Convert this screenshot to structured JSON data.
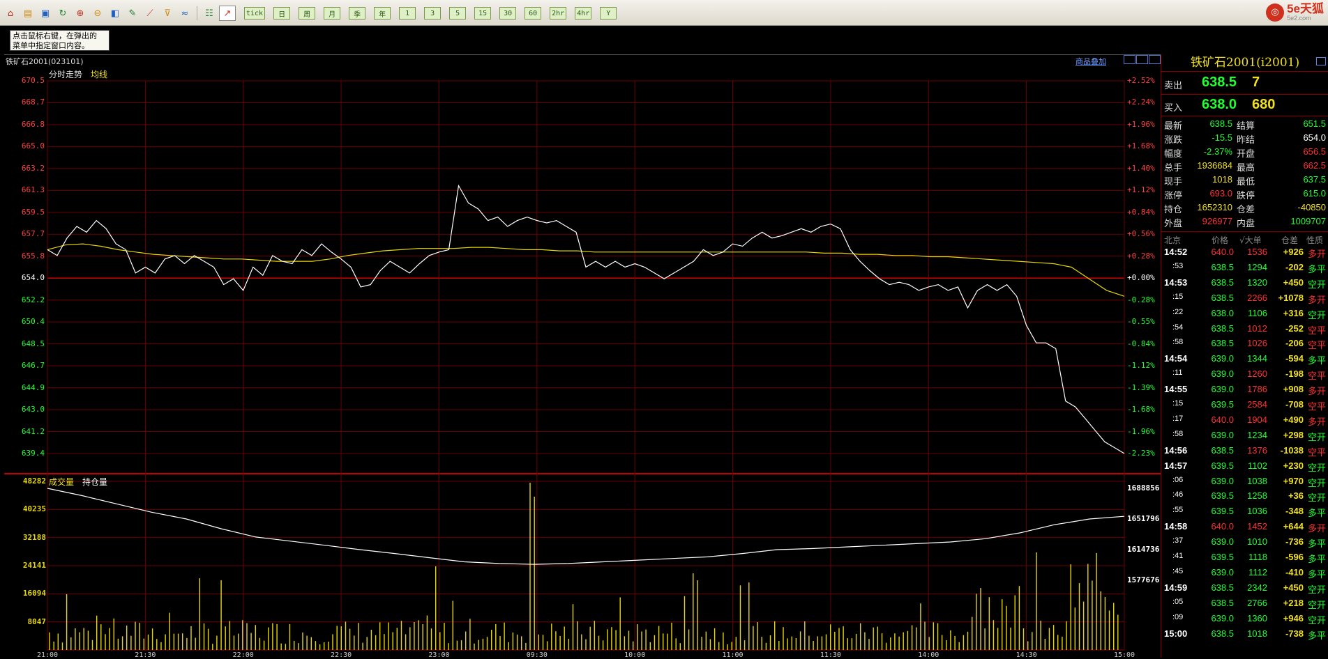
{
  "toolbar": {
    "icons": [
      "home-icon",
      "folder-icon",
      "layout-icon",
      "refresh-icon",
      "zoom-in-icon",
      "zoom-out-icon",
      "window-icon",
      "pen-icon",
      "chart-tool-icon",
      "filter-icon",
      "indicator-icon",
      "table-icon",
      "intraday-icon"
    ],
    "periods": [
      "tick",
      "日",
      "周",
      "月",
      "季",
      "年",
      "1",
      "3",
      "5",
      "15",
      "30",
      "60",
      "2hr",
      "4hr",
      "Y"
    ]
  },
  "logo": {
    "text": "5e天狐",
    "sub": "5e2.com"
  },
  "hint": {
    "line1": "点击鼠标右键，在弹出的",
    "line2": "菜单中指定窗口内容。"
  },
  "chart": {
    "instrument": "铁矿石2001",
    "code": "(023101)",
    "overlay_link": "商品叠加",
    "legend_price": "分时走势",
    "legend_avg": "均线",
    "legend_vol": "成交量",
    "legend_oi": "持仓量"
  },
  "chart_data": {
    "type": "line",
    "price_axis": [
      "670.5",
      "668.7",
      "666.8",
      "665.0",
      "663.2",
      "661.3",
      "659.5",
      "657.7",
      "655.8",
      "654.0",
      "652.2",
      "650.4",
      "648.5",
      "646.7",
      "644.9",
      "643.0",
      "641.2",
      "639.4"
    ],
    "pct_axis": [
      "+2.52%",
      "+2.24%",
      "+1.96%",
      "+1.68%",
      "+1.40%",
      "+1.12%",
      "+0.84%",
      "+0.56%",
      "+0.28%",
      "+0.00%",
      "-0.28%",
      "-0.55%",
      "-0.84%",
      "-1.12%",
      "-1.39%",
      "-1.68%",
      "-1.96%",
      "-2.23%"
    ],
    "vol_axis": [
      "48282",
      "40235",
      "32188",
      "24141",
      "16094",
      "8047"
    ],
    "oi_axis": [
      "1688856",
      "1651796",
      "1614736",
      "1577676"
    ],
    "x_labels": [
      "21:00",
      "21:30",
      "22:00",
      "22:30",
      "23:00",
      "09:30",
      "10:00",
      "11:00",
      "11:30",
      "14:00",
      "14:30",
      "15:00"
    ],
    "ylim": [
      638.5,
      670.5
    ],
    "prev_settle": 654.0,
    "price": [
      656,
      655.5,
      657,
      658,
      657.5,
      658.5,
      657.8,
      656.5,
      656,
      654,
      654.5,
      654,
      655.2,
      655.5,
      654.8,
      655.5,
      655,
      654.5,
      653,
      653.5,
      652.5,
      654.5,
      653.8,
      655.5,
      655,
      654.8,
      656,
      655.5,
      656.5,
      655.8,
      655.2,
      654.5,
      652.8,
      653,
      654.2,
      655,
      654.5,
      654,
      654.8,
      655.5,
      655.8,
      656,
      661.5,
      660,
      659.5,
      658.5,
      658.8,
      658,
      658.5,
      658.8,
      658.5,
      658.3,
      658.5,
      658,
      657.5,
      654.5,
      655,
      654.5,
      655,
      654.5,
      654.8,
      654.5,
      654,
      653.5,
      654,
      654.5,
      655,
      656,
      655.5,
      655.8,
      656.5,
      656.3,
      657,
      657.5,
      657,
      657.2,
      657.5,
      657.8,
      657.5,
      658,
      658.2,
      657.8,
      656,
      655,
      654.2,
      653.5,
      653,
      653.2,
      653,
      652.5,
      652.8,
      653,
      652.5,
      652.8,
      651,
      652.5,
      653,
      652.5,
      653,
      652,
      649.5,
      648,
      648,
      647.5,
      643,
      642.5,
      641.5,
      640.5,
      639.5,
      639,
      638.5
    ],
    "avg": [
      656,
      656.4,
      656.5,
      656.3,
      656,
      655.8,
      655.6,
      655.5,
      655.4,
      655.3,
      655.2,
      655.2,
      655.1,
      655,
      655,
      655,
      655.2,
      655.5,
      655.7,
      655.9,
      656,
      656.1,
      656.1,
      656.1,
      656.2,
      656.2,
      656.1,
      656,
      656,
      655.9,
      655.9,
      655.8,
      655.8,
      655.8,
      655.8,
      655.8,
      655.8,
      655.8,
      655.8,
      655.8,
      655.8,
      655.8,
      655.8,
      655.8,
      655.7,
      655.7,
      655.6,
      655.6,
      655.5,
      655.5,
      655.4,
      655.4,
      655.3,
      655.2,
      655.1,
      655,
      654.9,
      654.8,
      654.5,
      653.5,
      652.5,
      652
    ],
    "vol_note": "volume bars and open interest curve",
    "oi": [
      1688856,
      1680000,
      1670000,
      1660000,
      1651796,
      1640000,
      1630000,
      1625000,
      1620000,
      1614736,
      1610000,
      1605000,
      1600000,
      1598000,
      1597000,
      1598000,
      1600000,
      1602000,
      1604000,
      1606000,
      1610000,
      1614736,
      1616000,
      1618000,
      1620000,
      1622000,
      1624000,
      1628000,
      1635000,
      1645000,
      1651796,
      1655000
    ]
  },
  "side": {
    "title": "铁矿石2001(i2001)",
    "ask_label": "卖出",
    "ask_price": "638.5",
    "ask_vol": "7",
    "bid_label": "买入",
    "bid_price": "638.0",
    "bid_vol": "680",
    "stats": [
      {
        "l1": "最新",
        "v1": "638.5",
        "c1": "#20ff30",
        "l2": "结算",
        "v2": "651.5",
        "c2": "#20ff30"
      },
      {
        "l1": "涨跌",
        "v1": "-15.5",
        "c1": "#20ff30",
        "l2": "昨结",
        "v2": "654.0",
        "c2": "#ffffff"
      },
      {
        "l1": "幅度",
        "v1": "-2.37%",
        "c1": "#20ff30",
        "l2": "开盘",
        "v2": "656.5",
        "c2": "#ff3030"
      },
      {
        "l1": "总手",
        "v1": "1936684",
        "c1": "#f0e020",
        "l2": "最高",
        "v2": "662.5",
        "c2": "#ff3030"
      },
      {
        "l1": "现手",
        "v1": "1018",
        "c1": "#f0e020",
        "l2": "最低",
        "v2": "637.5",
        "c2": "#20ff30"
      },
      {
        "l1": "涨停",
        "v1": "693.0",
        "c1": "#ff3030",
        "l2": "跌停",
        "v2": "615.0",
        "c2": "#20ff30"
      },
      {
        "l1": "持仓",
        "v1": "1652310",
        "c1": "#f0e020",
        "l2": "仓差",
        "v2": "-40850",
        "c2": "#f0e020"
      },
      {
        "l1": "外盘",
        "v1": "926977",
        "c1": "#ff3030",
        "l2": "内盘",
        "v2": "1009707",
        "c2": "#20ff30"
      }
    ],
    "tick_headers": {
      "time": "北京",
      "price": "价格",
      "vol": "√大单",
      "oi": "仓差",
      "type": "性质"
    },
    "ticks": [
      {
        "t": "14:52",
        "p": "640.0",
        "v": "1536",
        "o": "+926",
        "k": "多开",
        "big": true
      },
      {
        "t": ":53",
        "p": "638.5",
        "v": "1294",
        "o": "-202",
        "k": "多平",
        "big": false
      },
      {
        "t": "14:53",
        "p": "638.5",
        "v": "1320",
        "o": "+450",
        "k": "空开",
        "big": true
      },
      {
        "t": ":15",
        "p": "638.5",
        "v": "2266",
        "o": "+1078",
        "k": "多开",
        "big": false
      },
      {
        "t": ":22",
        "p": "638.0",
        "v": "1106",
        "o": "+316",
        "k": "空开",
        "big": false
      },
      {
        "t": ":54",
        "p": "638.5",
        "v": "1012",
        "o": "-252",
        "k": "空平",
        "big": false
      },
      {
        "t": ":58",
        "p": "638.5",
        "v": "1026",
        "o": "-206",
        "k": "空平",
        "big": false
      },
      {
        "t": "14:54",
        "p": "639.0",
        "v": "1344",
        "o": "-594",
        "k": "多平",
        "big": true
      },
      {
        "t": ":11",
        "p": "639.0",
        "v": "1260",
        "o": "-198",
        "k": "空平",
        "big": false
      },
      {
        "t": "14:55",
        "p": "639.0",
        "v": "1786",
        "o": "+908",
        "k": "多开",
        "big": true
      },
      {
        "t": ":15",
        "p": "639.5",
        "v": "2584",
        "o": "-708",
        "k": "空平",
        "big": false
      },
      {
        "t": ":17",
        "p": "640.0",
        "v": "1904",
        "o": "+490",
        "k": "多开",
        "big": false
      },
      {
        "t": ":58",
        "p": "639.0",
        "v": "1234",
        "o": "+298",
        "k": "空开",
        "big": false
      },
      {
        "t": "14:56",
        "p": "638.5",
        "v": "1376",
        "o": "-1038",
        "k": "空平",
        "big": true
      },
      {
        "t": "14:57",
        "p": "639.5",
        "v": "1102",
        "o": "+230",
        "k": "空开",
        "big": true
      },
      {
        "t": ":06",
        "p": "639.0",
        "v": "1038",
        "o": "+970",
        "k": "空开",
        "big": false
      },
      {
        "t": ":46",
        "p": "639.5",
        "v": "1258",
        "o": "+36",
        "k": "空开",
        "big": false
      },
      {
        "t": ":55",
        "p": "639.5",
        "v": "1036",
        "o": "-348",
        "k": "多平",
        "big": false
      },
      {
        "t": "14:58",
        "p": "640.0",
        "v": "1452",
        "o": "+644",
        "k": "多开",
        "big": true
      },
      {
        "t": ":37",
        "p": "639.0",
        "v": "1010",
        "o": "-736",
        "k": "多平",
        "big": false
      },
      {
        "t": ":41",
        "p": "639.5",
        "v": "1118",
        "o": "-596",
        "k": "多平",
        "big": false
      },
      {
        "t": ":45",
        "p": "639.0",
        "v": "1112",
        "o": "-410",
        "k": "多平",
        "big": false
      },
      {
        "t": "14:59",
        "p": "638.5",
        "v": "2342",
        "o": "+450",
        "k": "空开",
        "big": true
      },
      {
        "t": ":05",
        "p": "638.5",
        "v": "2766",
        "o": "+218",
        "k": "空开",
        "big": false
      },
      {
        "t": ":09",
        "p": "639.0",
        "v": "1360",
        "o": "+946",
        "k": "空开",
        "big": false
      },
      {
        "t": "15:00",
        "p": "638.5",
        "v": "1018",
        "o": "-738",
        "k": "多平",
        "big": true
      }
    ]
  }
}
